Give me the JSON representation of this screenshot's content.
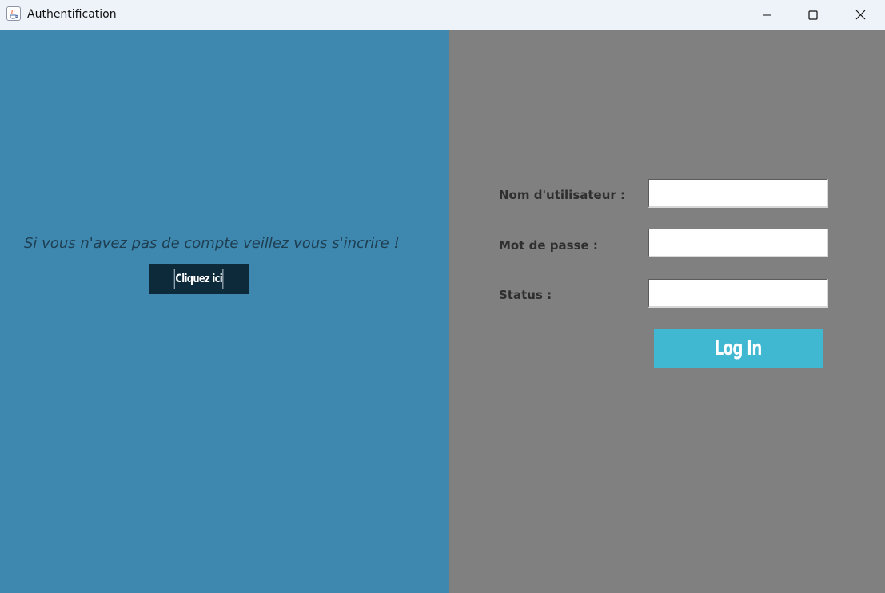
{
  "window": {
    "title": "Authentification",
    "controls": {
      "minimize": "minimize-icon",
      "maximize": "maximize-icon",
      "close": "close-icon"
    }
  },
  "left_panel": {
    "background": "#3e88b0",
    "message": "Si vous n'avez pas de compte veillez vous s'incrire !",
    "signup_button_label": "Cliquez ici",
    "signup_button_color": "#0d2a3b"
  },
  "right_panel": {
    "background": "#808080",
    "fields": {
      "username": {
        "label": "Nom d'utilisateur :",
        "value": ""
      },
      "password": {
        "label": "Mot de passe :",
        "value": ""
      },
      "status": {
        "label": "Status :",
        "value": ""
      }
    },
    "login_button_label": "Log In",
    "login_button_color": "#41b8d2"
  }
}
